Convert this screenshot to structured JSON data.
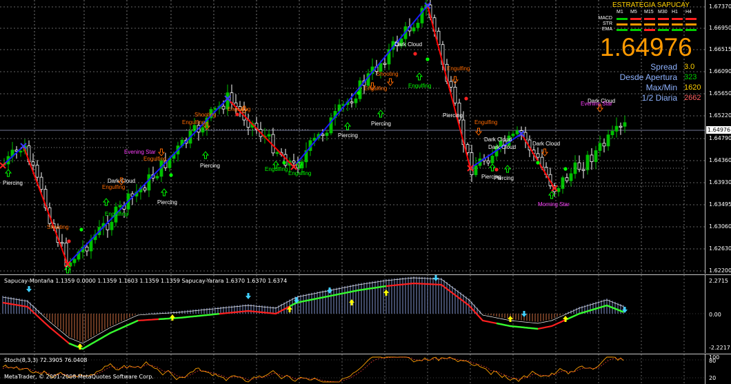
{
  "app": {
    "copyright": "MetaTrader, © 2001-2008 MetaQuotes Software Corp."
  },
  "main_chart": {
    "price_axis": [
      "1.67370",
      "1.66950",
      "1.66515",
      "1.66090",
      "1.65650",
      "1.65220",
      "1.64790",
      "1.64360",
      "1.63930",
      "1.63495",
      "1.63060",
      "1.62630",
      "1.62200"
    ],
    "current_price": "1.64976",
    "patterns": [
      "Piercing",
      "Shooting",
      "Engulfing",
      "Dark Cloud",
      "Engulfing",
      "Engulfing",
      "Evening Star",
      "Engulfing",
      "Piercing",
      "Shooting",
      "Engulfing",
      "Piercing",
      "Engulfing",
      "Engulfing",
      "Piercing",
      "Piercing",
      "Shooting",
      "Engulfing",
      "Dark Cloud",
      "Engulfing",
      "Engulfing",
      "Dark Cloud",
      "Piercing",
      "Engulfing",
      "Dark Cloud",
      "Piercing",
      "Piercing",
      "Dark Cloud",
      "Morning Star",
      "Dark Cloud",
      "Evening Star"
    ]
  },
  "panel": {
    "title": "ESTRATEGIA SAPUCAY",
    "timeframes": [
      "M1",
      "M5",
      "M15",
      "M30",
      "H1",
      "H4"
    ],
    "rows": [
      {
        "label": "MACD",
        "cells": [
          "#00d000",
          "#ff2020",
          "#ff2020",
          "#ff2020",
          "#ff2020",
          "#ff2020"
        ]
      },
      {
        "label": "STR",
        "cells": [
          "#ff9a00",
          "#ff9a00",
          "#ff9a00",
          "#ff9a00",
          "#ff9a00",
          "#ff9a00"
        ]
      },
      {
        "label": "EMA",
        "cells": [
          "#00d000",
          "#00d000",
          "#ff2020",
          "#00d000",
          "#00d000",
          "#00d000"
        ]
      }
    ],
    "bid": "1.64976",
    "stats": [
      {
        "label": "Spread",
        "value": "3.0",
        "color": "#ffd000"
      },
      {
        "label": "Desde Apertura",
        "value": "323",
        "color": "#00d000"
      },
      {
        "label": "Max/Min",
        "value": "1620",
        "color": "#ffd000"
      },
      {
        "label": "1/2 Diaria",
        "value": "2662",
        "color": "#ff6060"
      }
    ]
  },
  "indicator1": {
    "label": "Sapucay-Montaña 1.1359 0.0000 1.1359 1.1603 1.1359 1.1359  Sapucay-Yarara 1.6370 1.6370 1.6374",
    "axis": [
      "2.2715",
      "0.00",
      "-2.2217"
    ]
  },
  "indicator2": {
    "label": "Stoch(8,3,3) 72.3905 76.0408",
    "axis": [
      "100",
      "80",
      "20"
    ]
  },
  "colors": {
    "bull": "#00c000",
    "bear": "#ffffff",
    "zigzag_up": "#1a1aff",
    "zigzag_down": "#ff0000",
    "grid": "#c8c8c8",
    "signal_up": "#00ff00",
    "signal_down": "#ff2020"
  }
}
